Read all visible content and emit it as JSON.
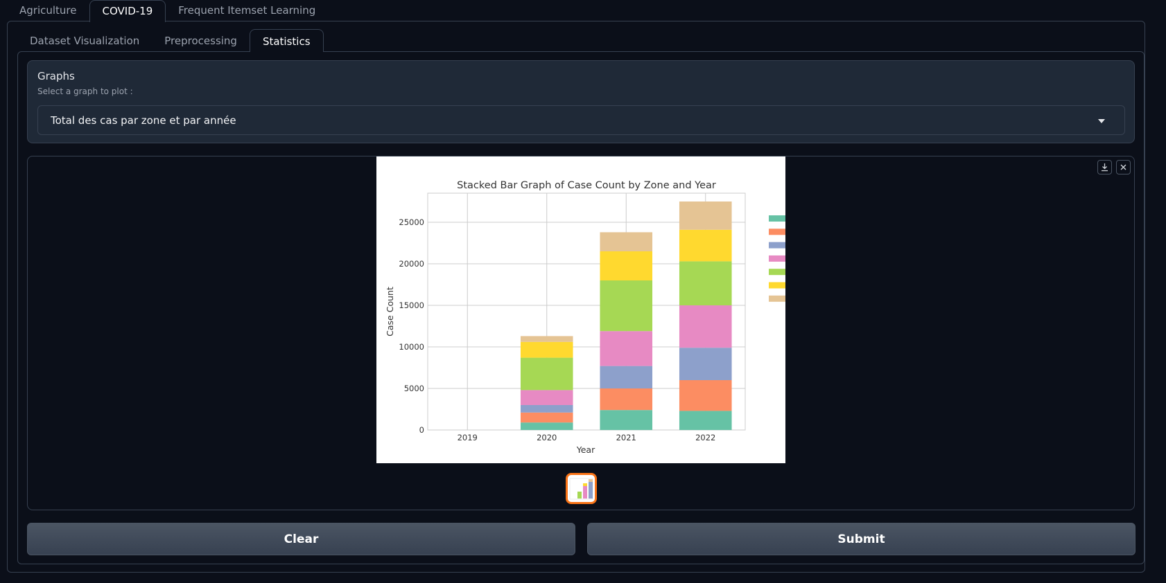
{
  "tabs_top": [
    "Agriculture",
    "COVID-19",
    "Frequent Itemset Learning"
  ],
  "tabs_inner": [
    "Dataset Visualization",
    "Preprocessing",
    "Statistics"
  ],
  "graphs": {
    "title": "Graphs",
    "subtitle": "Select a graph to plot :",
    "selected": "Total des cas par zone et par année"
  },
  "buttons": {
    "clear": "Clear",
    "submit": "Submit"
  },
  "chart_data": {
    "type": "bar",
    "stacked": true,
    "title": "Stacked Bar Graph of Case Count by Zone and Year",
    "xlabel": "Year",
    "ylabel": "Case Count",
    "categories": [
      "2019",
      "2020",
      "2021",
      "2022"
    ],
    "ylim": [
      0,
      28500
    ],
    "yticks": [
      0,
      5000,
      10000,
      15000,
      20000,
      25000
    ],
    "grid": true,
    "legend_position": "right (cropped)",
    "series": [
      {
        "color": "#66c2a5",
        "values": [
          0,
          900,
          2400,
          2300
        ]
      },
      {
        "color": "#fc8d62",
        "values": [
          0,
          1200,
          2600,
          3700
        ]
      },
      {
        "color": "#8da0cb",
        "values": [
          0,
          900,
          2700,
          3900
        ]
      },
      {
        "color": "#e78ac3",
        "values": [
          0,
          1800,
          4200,
          5100
        ]
      },
      {
        "color": "#a6d854",
        "values": [
          0,
          3900,
          6100,
          5300
        ]
      },
      {
        "color": "#ffd92f",
        "values": [
          0,
          1900,
          3500,
          3800
        ]
      },
      {
        "color": "#e5c494",
        "values": [
          0,
          700,
          2300,
          3400
        ]
      }
    ]
  }
}
